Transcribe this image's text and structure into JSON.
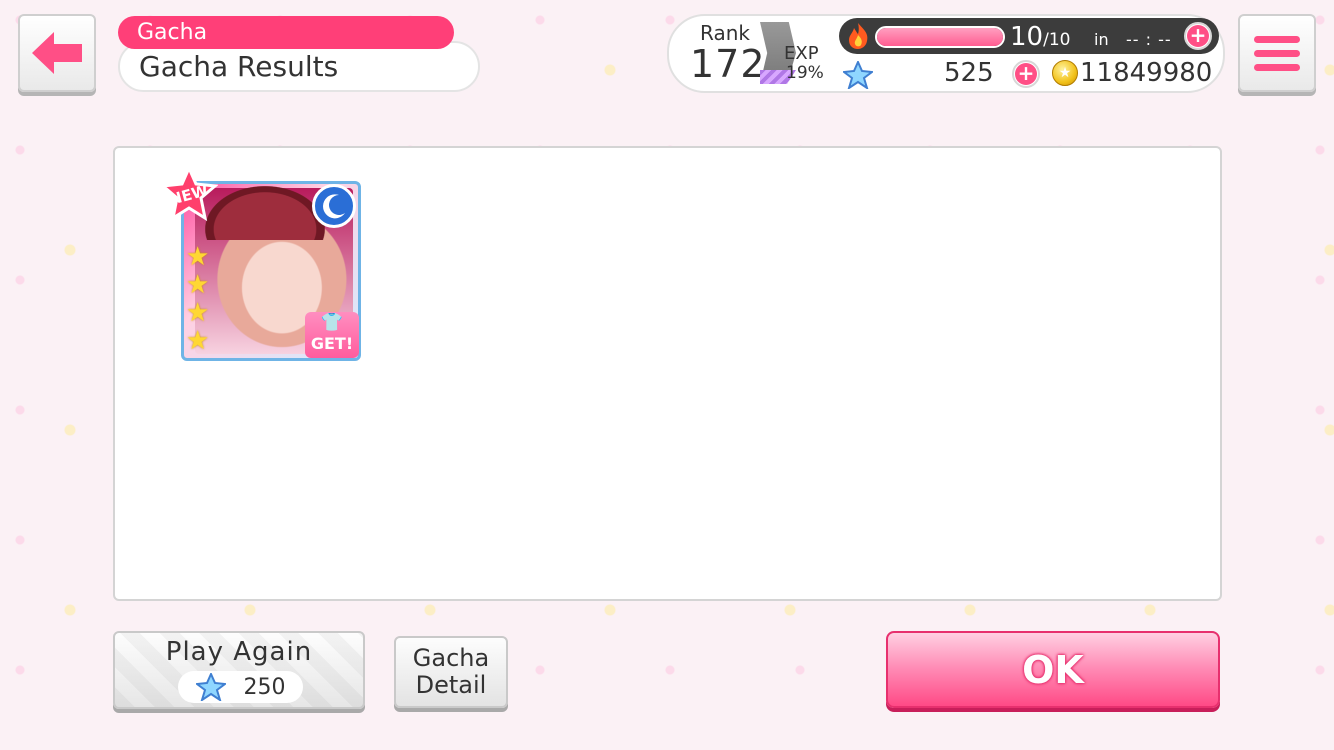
{
  "header": {
    "breadcrumb": "Gacha",
    "title": "Gacha Results"
  },
  "status": {
    "rank_label": "Rank",
    "rank_value": "172",
    "exp_label": "EXP",
    "exp_value": "19%",
    "stamina_current": "10",
    "stamina_max": "/10",
    "stamina_fill_fraction": 1.0,
    "stamina_in_label": "in",
    "stamina_timer": "-- : --",
    "star_gems": "525",
    "coins": "11849980"
  },
  "result_card": {
    "new_badge": "NEW",
    "rarity": 4,
    "attribute": "cool",
    "get_badge": "GET!"
  },
  "buttons": {
    "play_again_label": "Play Again",
    "play_again_cost": "250",
    "gacha_detail_line1": "Gacha",
    "gacha_detail_line2": "Detail",
    "ok_label": "OK"
  },
  "colors": {
    "accent": "#ff3f78",
    "ok_button": "#ff4a86",
    "attribute_cool": "#2a6ed6"
  },
  "icons": [
    "back-arrow-icon",
    "menu-icon",
    "flame-icon",
    "plus-icon",
    "star-gem-icon",
    "coin-icon",
    "moon-icon",
    "rarity-star-icon",
    "shirt-icon"
  ]
}
